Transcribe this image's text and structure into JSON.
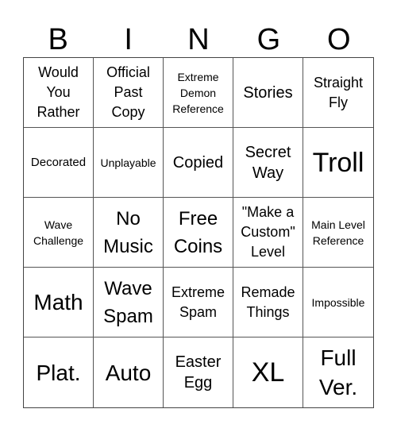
{
  "header": [
    "B",
    "I",
    "N",
    "G",
    "O"
  ],
  "cells": [
    "Would You Rather",
    "Official Past Copy",
    "Extreme Demon Reference",
    "Stories",
    "Straight Fly",
    "Decorated",
    "Unplayable",
    "Copied",
    "Secret Way",
    "Troll",
    "Wave Challenge",
    "No Music",
    "Free Coins",
    "\"Make a Custom\" Level",
    "Main Level Reference",
    "Math",
    "Wave Spam",
    "Extreme Spam",
    "Remade Things",
    "Impossible",
    "Plat.",
    "Auto",
    "Easter Egg",
    "XL",
    "Full Ver."
  ]
}
